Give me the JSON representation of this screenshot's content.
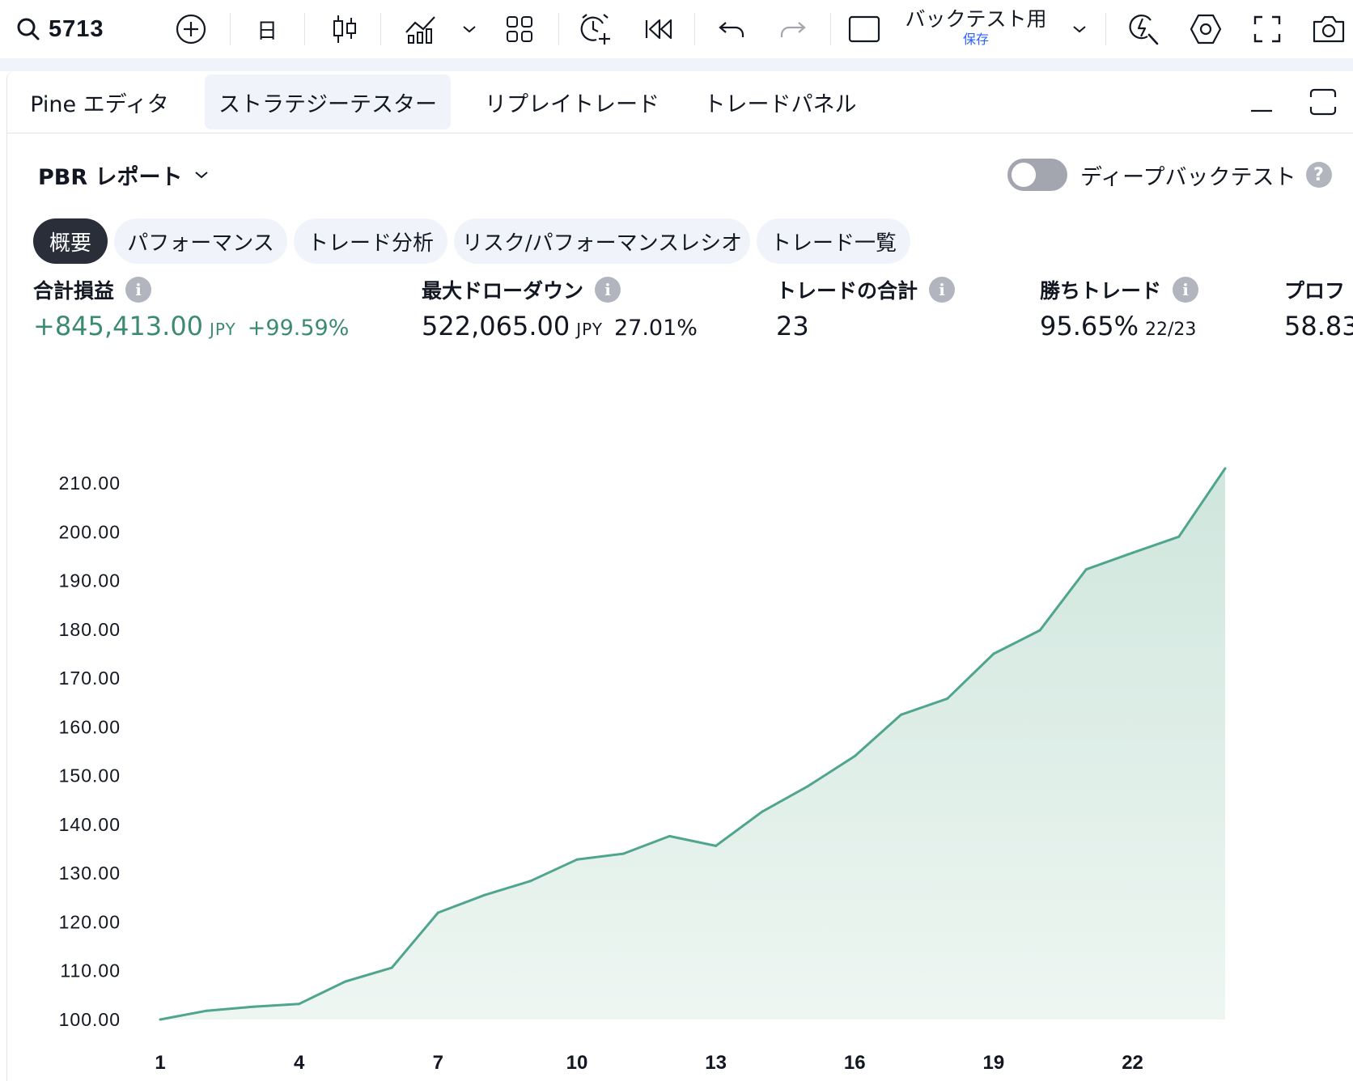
{
  "toolbar": {
    "symbol": "5713",
    "interval": "日",
    "layout_name": "バックテスト用",
    "layout_status": "保存"
  },
  "panel_tabs": [
    {
      "label": "Pine エディタ",
      "active": false
    },
    {
      "label": "ストラテジーテスター",
      "active": true
    },
    {
      "label": "リプレイトレード",
      "active": false
    },
    {
      "label": "トレードパネル",
      "active": false
    }
  ],
  "report": {
    "title": "PBR レポート",
    "deep_backtest_label": "ディープバックテスト",
    "deep_backtest_enabled": false,
    "help_symbol": "?"
  },
  "report_tabs": [
    {
      "label": "概要",
      "active": true
    },
    {
      "label": "パフォーマンス",
      "active": false
    },
    {
      "label": "トレード分析",
      "active": false
    },
    {
      "label": "リスク/パフォーマンスレシオ",
      "active": false
    },
    {
      "label": "トレード一覧",
      "active": false
    }
  ],
  "metrics": {
    "net_profit": {
      "label": "合計損益",
      "value": "+845,413.00",
      "unit": "JPY",
      "pct": "+99.59%"
    },
    "max_drawdown": {
      "label": "最大ドローダウン",
      "value": "522,065.00",
      "unit": "JPY",
      "pct": "27.01%"
    },
    "total_trades": {
      "label": "トレードの合計",
      "value": "23"
    },
    "win_trades": {
      "label": "勝ちトレード",
      "value": "95.65%",
      "sub": "22/23"
    },
    "profit_factor": {
      "label": "プロフ",
      "value": "58.83"
    }
  },
  "colors": {
    "positive": "#3d8b6f",
    "line": "#4fa58e",
    "fill": "#d2e8e0",
    "active_pill": "#2a2e39"
  },
  "chart_data": {
    "type": "area",
    "x": [
      1,
      2,
      3,
      4,
      5,
      6,
      7,
      8,
      9,
      10,
      11,
      12,
      13,
      14,
      15,
      16,
      17,
      18,
      19,
      20,
      21,
      22,
      23,
      24
    ],
    "values": [
      100.0,
      101.8,
      102.6,
      103.2,
      107.8,
      110.6,
      121.9,
      125.5,
      128.4,
      132.8,
      134.0,
      137.6,
      135.6,
      142.6,
      147.9,
      154.0,
      162.5,
      165.8,
      175.0,
      179.8,
      192.3,
      195.7,
      199.0,
      213.0
    ],
    "x_ticks": [
      1,
      4,
      7,
      10,
      13,
      16,
      19,
      22
    ],
    "y_ticks": [
      "100.00",
      "110.00",
      "120.00",
      "130.00",
      "140.00",
      "150.00",
      "160.00",
      "170.00",
      "180.00",
      "190.00",
      "200.00",
      "210.00"
    ],
    "ylim": [
      100,
      210
    ],
    "xlim": [
      1,
      24
    ],
    "grid": false
  }
}
